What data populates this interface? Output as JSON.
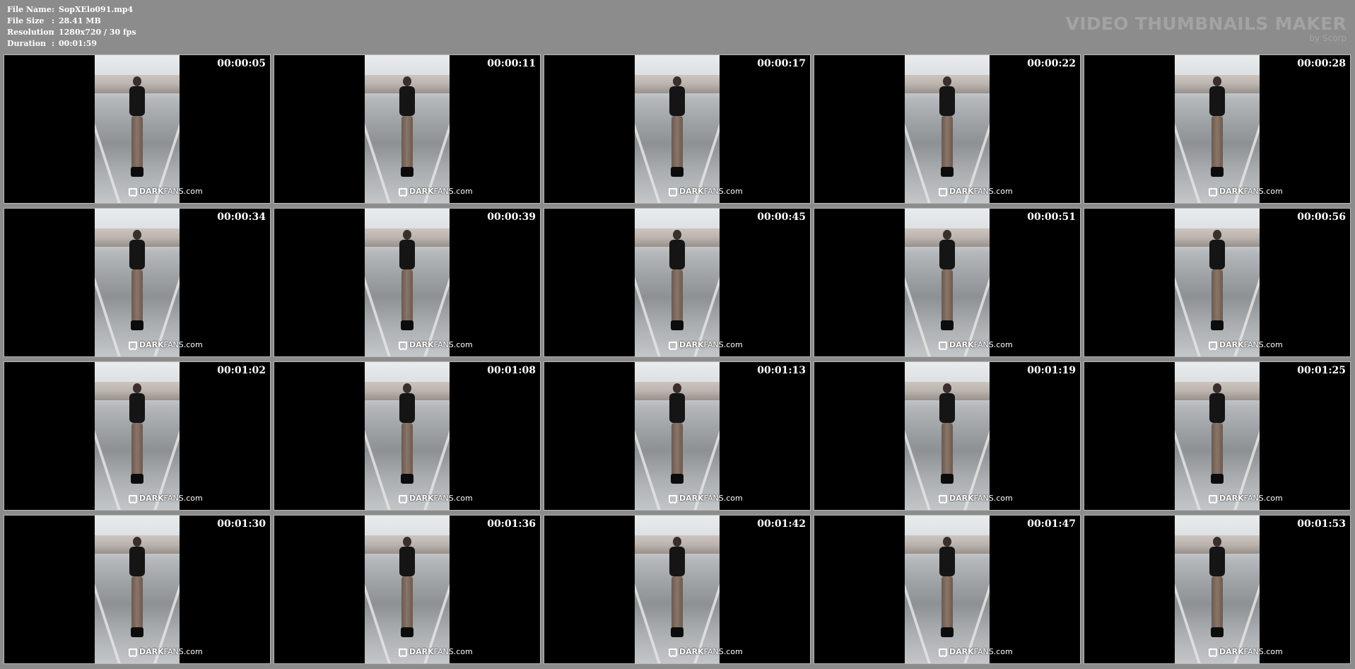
{
  "info": {
    "file_name_label": "File Name",
    "file_name": "SopXElo091.mp4",
    "file_size_label": "File Size",
    "file_size": "28.41 MB",
    "resolution_label": "Resolution",
    "resolution": "1280x720 / 30 fps",
    "duration_label": "Duration",
    "duration": "00:01:59",
    "separator": ":"
  },
  "brand": {
    "title": "VIDEO THUMBNAILS MAKER",
    "subtitle": "by Scorp"
  },
  "watermark": {
    "bold": "DARK",
    "rest": "FANS.com"
  },
  "thumbnails": [
    {
      "time": "00:00:05"
    },
    {
      "time": "00:00:11"
    },
    {
      "time": "00:00:17"
    },
    {
      "time": "00:00:22"
    },
    {
      "time": "00:00:28"
    },
    {
      "time": "00:00:34"
    },
    {
      "time": "00:00:39"
    },
    {
      "time": "00:00:45"
    },
    {
      "time": "00:00:51"
    },
    {
      "time": "00:00:56"
    },
    {
      "time": "00:01:02"
    },
    {
      "time": "00:01:08"
    },
    {
      "time": "00:01:13"
    },
    {
      "time": "00:01:19"
    },
    {
      "time": "00:01:25"
    },
    {
      "time": "00:01:30"
    },
    {
      "time": "00:01:36"
    },
    {
      "time": "00:01:42"
    },
    {
      "time": "00:01:47"
    },
    {
      "time": "00:01:53"
    }
  ]
}
